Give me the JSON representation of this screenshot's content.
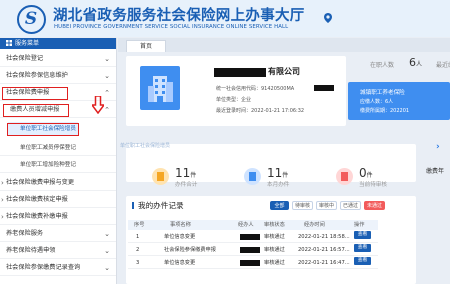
{
  "header": {
    "title": "湖北省政务服务社会保险网上办事大厅",
    "subtitle": "HUBEI PROVINCE GOVERNMENT SERVICE SOCIAL INSURANCE ONLINE SERVICE HALL",
    "logo_letter": "S"
  },
  "sidebar": {
    "heading": "服务菜单",
    "items": [
      {
        "label": "社会保险登记"
      },
      {
        "label": "社会保险参保信息维护"
      },
      {
        "label": "社会保险费申报"
      },
      {
        "label": "缴费人员增减申报"
      },
      {
        "label": "单位职工社会保险增员"
      },
      {
        "label": "单位职工减员停保登记"
      },
      {
        "label": "单位职工增加险种登记"
      },
      {
        "label": "社会保险缴费申报与变更"
      },
      {
        "label": "社会保险缴费核定申报"
      },
      {
        "label": "社会保险缴费补缴申报"
      },
      {
        "label": "养老保险服务"
      },
      {
        "label": "养老保险待遇申领"
      },
      {
        "label": "社会保险参保缴费记录查询"
      }
    ]
  },
  "tabs": {
    "home": "首页"
  },
  "company": {
    "name_suffix": "有限公司",
    "credit_code": "统一社会信用代码：91420500MA",
    "unit_type": "单位类型：企业",
    "last_login": "最近登录时间：2022-01-21 17:06:32"
  },
  "stats": {
    "insured_label": "在职人数",
    "insured_value": "6",
    "insured_unit": "人",
    "retired_label": "最近缴"
  },
  "notice": {
    "title": "城镇职工养老保险",
    "line1": "应缴人数：6人",
    "line2": "缴费所属期：202201"
  },
  "counters": [
    {
      "value": "11",
      "unit": "件",
      "label": "办件合计"
    },
    {
      "value": "11",
      "unit": "件",
      "label": "本月办件"
    },
    {
      "value": "0",
      "unit": "件",
      "label": "当前待审核"
    }
  ],
  "records": {
    "title": "我的办件记录",
    "filters": [
      "全部",
      "待审核",
      "审核中",
      "已通过",
      "未通过"
    ],
    "headers": [
      "序号",
      "事项名称",
      "经办人",
      "审核状态",
      "经办时间",
      "操作"
    ],
    "rows": [
      {
        "no": "1",
        "name": "单位信息变更",
        "status": "审核通过",
        "time": "2022-01-21 18:58...",
        "op": "查看"
      },
      {
        "no": "2",
        "name": "社会保险参保缴费申报",
        "status": "审核通过",
        "time": "2022-01-21 16:57...",
        "op": "查看"
      },
      {
        "no": "3",
        "name": "单位信息变更",
        "status": "审核通过",
        "time": "2022-01-21 16:47...",
        "op": "查看"
      }
    ]
  },
  "right_panel": {
    "label": "缴费年"
  },
  "overlay_hint": "单位职工社会保险增员",
  "colors": {
    "brand": "#1a5fb4",
    "highlight": "#e02020",
    "accent": "#3f8ef0"
  }
}
